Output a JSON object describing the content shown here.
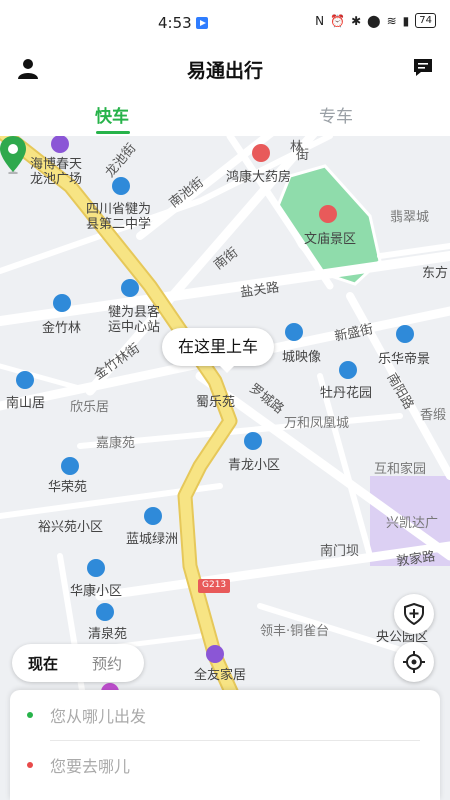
{
  "status_bar": {
    "time": "4:53",
    "battery": "74"
  },
  "header": {
    "title": "易通出行"
  },
  "tabs": [
    {
      "label": "快车",
      "active": true
    },
    {
      "label": "专车",
      "active": false
    }
  ],
  "map": {
    "pickup_bubble": "在这里上车",
    "labels": {
      "haibo": "海博春天",
      "longchi_plaza": "龙池广场",
      "longchi_st": "龙池街",
      "school1": "四川省犍为",
      "school2": "县第二中学",
      "nanchi_st": "南池街",
      "hongkang": "鸿康大药房",
      "lin_st": "林",
      "jie": "街",
      "cuicui": "翡翠城",
      "wenmiao": "文庙景区",
      "dongfang": "东方",
      "nan_st": "南街",
      "yanguan": "盐关路",
      "bus1": "犍为县客",
      "bus2": "运中心站",
      "jinzhulin": "金竹林",
      "jinzhulin_st": "金竹林街",
      "xinsheng": "新盛街",
      "chengying": "城映像",
      "lehua": "乐华帝景",
      "nanshan": "南山居",
      "xinle": "欣乐居",
      "shuleyuan": "蜀乐苑",
      "luocheng": "罗城路",
      "mudan": "牡丹花园",
      "nanyang": "南阳路",
      "xiangyu": "香缎",
      "wanhe": "万和凤凰城",
      "jiakang": "嘉康苑",
      "qinglong": "青龙小区",
      "huyu": "互和家园",
      "huarong": "华荣苑",
      "yuxing": "裕兴苑小区",
      "lancheng": "蓝城绿洲",
      "xingkaida": "兴凯达广",
      "nanmenba": "南门坝",
      "dunjia": "敦家路",
      "huakang": "华康小区",
      "g213": "G213",
      "qingquan": "清泉苑",
      "lingfeng": "领丰·铜雀台",
      "yanggong": "央公园区",
      "quanyou": "全友家居"
    }
  },
  "time_toggle": {
    "now": "现在",
    "reserve": "预约"
  },
  "trip_form": {
    "origin_placeholder": "您从哪儿出发",
    "destination_placeholder": "您要去哪儿"
  },
  "colors": {
    "accent": "#27b34a",
    "origin_dot": "#27b34a",
    "dest_dot": "#e84a4a",
    "main_road": "#f6e07a",
    "park": "#8fdcab",
    "district": "#d9ccf2"
  },
  "icons": {
    "user": "person-icon",
    "message": "chat-icon",
    "safety": "shield-plus-icon",
    "locate": "crosshair-icon"
  }
}
